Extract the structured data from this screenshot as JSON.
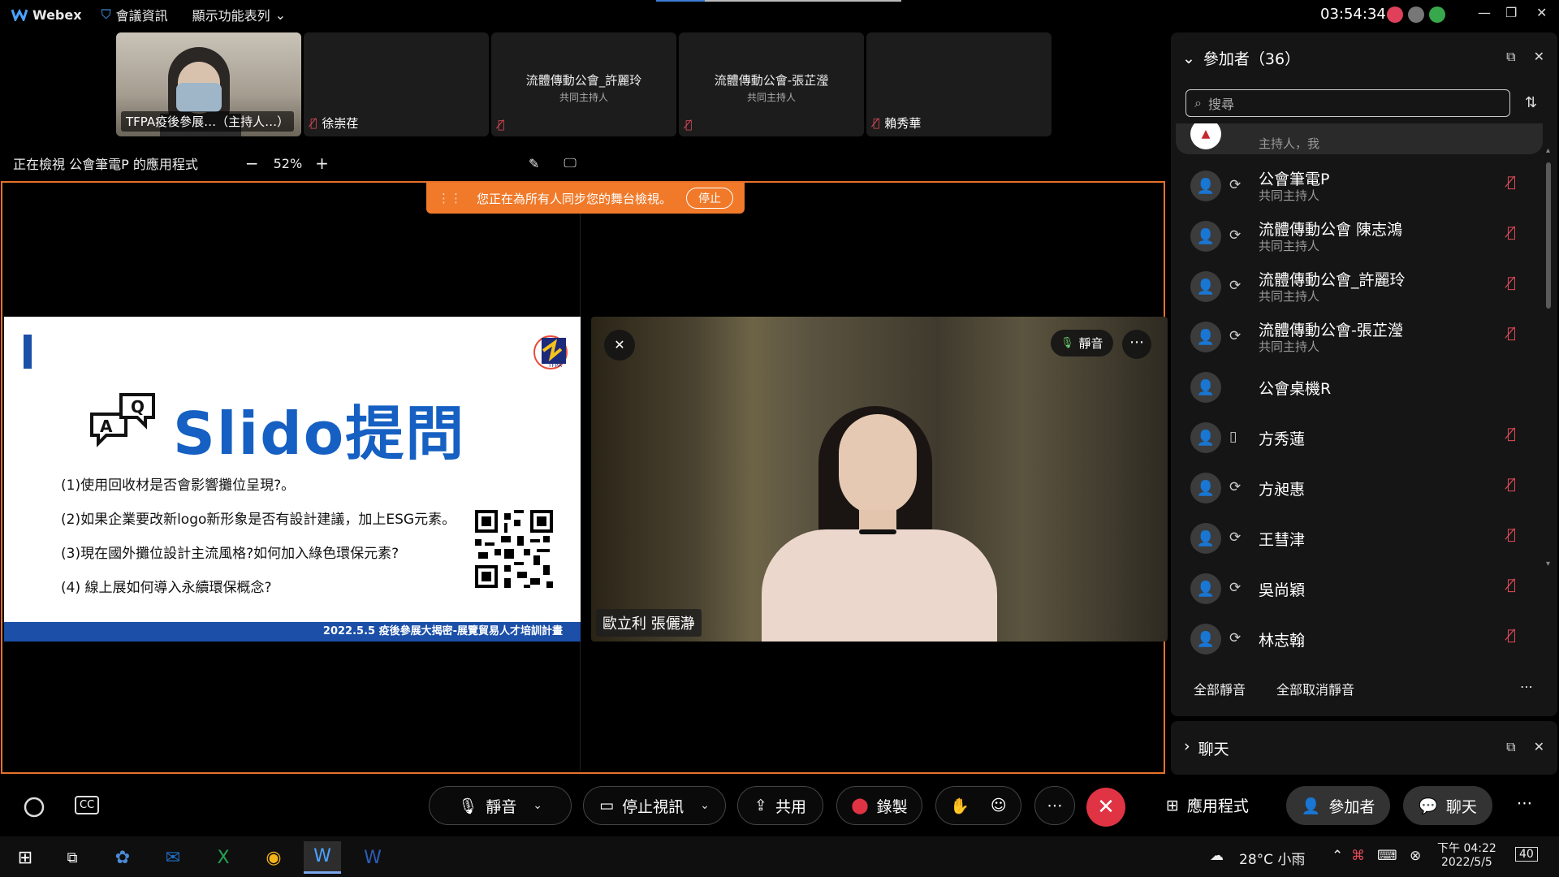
{
  "app": {
    "name": "Webex",
    "meeting_info": "會議資訊",
    "feature_list": "顯示功能表列",
    "clock": "03:54:34"
  },
  "thumbnails": [
    {
      "name": "TFPA疫後參展…（主持人…）",
      "role": "",
      "type": "video"
    },
    {
      "name": "徐崇荏",
      "role": "",
      "type": "blank"
    },
    {
      "name": "流體傳動公會_許麗玲",
      "role": "共同主持人",
      "type": "centered"
    },
    {
      "name": "流體傳動公會-張芷瀅",
      "role": "共同主持人",
      "type": "centered"
    },
    {
      "name": "賴秀華",
      "role": "",
      "type": "blank"
    }
  ],
  "viewbar": {
    "text": "正在檢視 公會筆電P 的應用程式",
    "zoom": "52%",
    "minus": "−",
    "plus": "+"
  },
  "sync_banner": {
    "text": "您正在為所有人同步您的舞台檢視。",
    "stop": "停止"
  },
  "slide": {
    "title": "Slido提問",
    "questions": [
      "(1)使用回收材是否會影響攤位呈現?。",
      "(2)如果企業要改新logo新形象是否有設計建議，加上ESG元素。",
      "(3)現在國外攤位設計主流風格?如何加入綠色環保元素?",
      "(4) 線上展如何導入永續環保概念?"
    ],
    "footer": "2022.5.5 疫後參展大揭密-展覽貿易人才培訓計畫",
    "logo_text": "TFPA"
  },
  "speaker": {
    "name": "歐立利 張儷瀞",
    "mute": "靜音",
    "more": "⋯"
  },
  "participants_panel": {
    "title": "參加者（36）",
    "search_placeholder": "搜尋",
    "partial_top_role": "主持人，我",
    "participants": [
      {
        "name": "公會筆電P",
        "role": "共同主持人",
        "device": "⟳",
        "muted": true
      },
      {
        "name": "流體傳動公會 陳志鴻",
        "role": "共同主持人",
        "device": "⟳",
        "muted": true
      },
      {
        "name": "流體傳動公會_許麗玲",
        "role": "共同主持人",
        "device": "⟳",
        "muted": true
      },
      {
        "name": "流體傳動公會-張芷瀅",
        "role": "共同主持人",
        "device": "⟳",
        "muted": true
      },
      {
        "name": "公會桌機R",
        "role": "",
        "device": "",
        "muted": false
      },
      {
        "name": "方秀蓮",
        "role": "",
        "device": "▯",
        "muted": true
      },
      {
        "name": "方昶惠",
        "role": "",
        "device": "⟳",
        "muted": true
      },
      {
        "name": "王彗津",
        "role": "",
        "device": "⟳",
        "muted": true
      },
      {
        "name": "吳尚穎",
        "role": "",
        "device": "⟳",
        "muted": true
      },
      {
        "name": "林志翰",
        "role": "",
        "device": "⟳",
        "muted": true
      }
    ],
    "mute_all": "全部靜音",
    "unmute_all": "全部取消靜音",
    "more": "⋯"
  },
  "chat_panel": {
    "title": "聊天"
  },
  "controls": {
    "mute": "靜音",
    "stop_video": "停止視訊",
    "share": "共用",
    "record": "錄製",
    "more": "⋯",
    "apps": "應用程式",
    "participants": "參加者",
    "chat": "聊天",
    "overflow": "⋯"
  },
  "taskbar": {
    "weather": "28°C 小雨",
    "time": "下午 04:22",
    "date": "2022/5/5",
    "notifications": "40"
  },
  "colors": {
    "stage_border": "#e8712a",
    "banner": "#f07a2a",
    "end_call": "#e03344",
    "muted_red": "#e24b59",
    "slide_blue": "#1b4fa8"
  }
}
